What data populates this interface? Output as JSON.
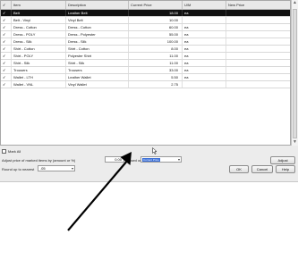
{
  "grid": {
    "headers": {
      "check": "✓",
      "item": "Item",
      "description": "Description",
      "current_price": "Current Price",
      "um": "U/M",
      "new_price": "New Price"
    },
    "rows": [
      {
        "check": "✓",
        "item": "Belt",
        "description": "Leather Belt",
        "price": "18.00",
        "um": "ea",
        "selected": true
      },
      {
        "check": "✓",
        "item": "Belt - Vinyl",
        "description": "Vinyl Belt",
        "price": "10.00",
        "um": ""
      },
      {
        "check": "✓",
        "item": "Dress - Cotton",
        "description": "Dress - Cotton",
        "price": "60.00",
        "um": "ea"
      },
      {
        "check": "✓",
        "item": "Dress - POLY",
        "description": "Dress - Polyester",
        "price": "55.00",
        "um": "ea"
      },
      {
        "check": "✓",
        "item": "Dress - Silk",
        "description": "Dress - Silk",
        "price": "100.00",
        "um": "ea"
      },
      {
        "check": "✓",
        "item": "Shirt - Cotton",
        "description": "Shirt - Cotton",
        "price": "8.00",
        "um": "ea"
      },
      {
        "check": "✓",
        "item": "Shirt - POLY",
        "description": "Polyester Shirt",
        "price": "11.00",
        "um": "ea"
      },
      {
        "check": "✓",
        "item": "Shirt - Silk",
        "description": "Shirt - Silk",
        "price": "11.00",
        "um": "ea"
      },
      {
        "check": "✓",
        "item": "Trousers",
        "description": "Trousers",
        "price": "33.00",
        "um": "ea"
      },
      {
        "check": "✓",
        "item": "Wallet - LTH",
        "description": "Leather Wallet",
        "price": "5.50",
        "um": "ea"
      },
      {
        "check": "✓",
        "item": "Wallet - VNL",
        "description": "Vinyl Wallet",
        "price": "2.75",
        "um": ""
      }
    ]
  },
  "controls": {
    "mark_all_label": "Mark All",
    "adjust_label": "Adjust price of marked items by (amount or %)",
    "adjust_value": "0.00",
    "based_on_label": "based on",
    "based_on_value": "Current Price",
    "adjust_button": "Adjust",
    "round_label": "Round up to nearest",
    "round_value": ".05",
    "ok_button": "OK",
    "cancel_button": "Cancel",
    "help_button": "Help"
  }
}
